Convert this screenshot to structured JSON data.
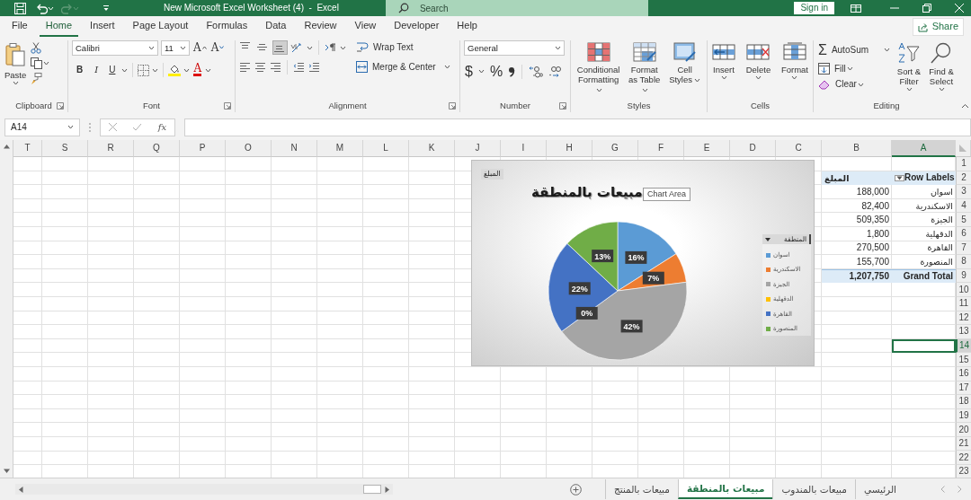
{
  "title_bar": {
    "title": "New Microsoft Excel Worksheet (4)  -  Excel",
    "redo_disabled": true,
    "search": {
      "placeholder": "Search"
    },
    "sign_in": "Sign in"
  },
  "menu": [
    {
      "label": "File",
      "selected": false
    },
    {
      "label": "Home",
      "selected": true
    },
    {
      "label": "Insert",
      "selected": false
    },
    {
      "label": "Page Layout",
      "selected": false
    },
    {
      "label": "Formulas",
      "selected": false
    },
    {
      "label": "Data",
      "selected": false
    },
    {
      "label": "Review",
      "selected": false
    },
    {
      "label": "View",
      "selected": false
    },
    {
      "label": "Developer",
      "selected": false
    },
    {
      "label": "Help",
      "selected": false
    }
  ],
  "share": "Share",
  "ribbon": {
    "clipboard": {
      "paste": "Paste",
      "label": "Clipboard"
    },
    "font": {
      "font_name": "Calibri",
      "font_size": "11",
      "grow": "A",
      "shrink": "A",
      "bold": "B",
      "italic": "I",
      "underline": "U",
      "font_color": "A",
      "label": "Font"
    },
    "alignment": {
      "vertical": [
        {
          "selected": false
        },
        {
          "selected": false
        },
        {
          "selected": true
        }
      ],
      "wrap_text": "Wrap Text",
      "merge": "Merge & Center",
      "label": "Alignment"
    },
    "number": {
      "format": "General",
      "currency": "$",
      "percent": "%",
      "label": "Number"
    },
    "styles": {
      "buttons": [
        {
          "label": "Conditional Formatting"
        },
        {
          "label": "Format as Table"
        },
        {
          "label": "Cell Styles"
        }
      ],
      "label": "Styles"
    },
    "cells": {
      "buttons": [
        {
          "label": "Insert"
        },
        {
          "label": "Delete"
        },
        {
          "label": "Format"
        }
      ],
      "label": "Cells"
    },
    "editing": {
      "autosum_sign": "Σ",
      "autosum": "AutoSum",
      "fill": "Fill",
      "clear": "Clear",
      "sort": "Sort & Filter",
      "find": "Find & Select",
      "label": "Editing"
    }
  },
  "formula_bar": {
    "name_box": "A14",
    "function_sign": "fx"
  },
  "sheet": {
    "columns": [
      {
        "label": "T",
        "selected": false
      },
      {
        "label": "S",
        "selected": false
      },
      {
        "label": "R",
        "selected": false
      },
      {
        "label": "Q",
        "selected": false
      },
      {
        "label": "P",
        "selected": false
      },
      {
        "label": "O",
        "selected": false
      },
      {
        "label": "N",
        "selected": false
      },
      {
        "label": "M",
        "selected": false
      },
      {
        "label": "L",
        "selected": false
      },
      {
        "label": "K",
        "selected": false
      },
      {
        "label": "J",
        "selected": false
      },
      {
        "label": "I",
        "selected": false
      },
      {
        "label": "H",
        "selected": false
      },
      {
        "label": "G",
        "selected": false
      },
      {
        "label": "F",
        "selected": false
      },
      {
        "label": "E",
        "selected": false
      },
      {
        "label": "D",
        "selected": false
      },
      {
        "label": "C",
        "selected": false
      },
      {
        "label": "B",
        "selected": false
      },
      {
        "label": "A",
        "selected": true
      }
    ],
    "rows": [
      {
        "label": "1",
        "selected": false
      },
      {
        "label": "2",
        "selected": false
      },
      {
        "label": "3",
        "selected": false
      },
      {
        "label": "4",
        "selected": false
      },
      {
        "label": "5",
        "selected": false
      },
      {
        "label": "6",
        "selected": false
      },
      {
        "label": "7",
        "selected": false
      },
      {
        "label": "8",
        "selected": false
      },
      {
        "label": "9",
        "selected": false
      },
      {
        "label": "10",
        "selected": false
      },
      {
        "label": "11",
        "selected": false
      },
      {
        "label": "12",
        "selected": false
      },
      {
        "label": "13",
        "selected": false
      },
      {
        "label": "14",
        "selected": true
      },
      {
        "label": "15",
        "selected": false
      },
      {
        "label": "16",
        "selected": false
      },
      {
        "label": "17",
        "selected": false
      },
      {
        "label": "18",
        "selected": false
      },
      {
        "label": "19",
        "selected": false
      },
      {
        "label": "20",
        "selected": false
      },
      {
        "label": "21",
        "selected": false
      },
      {
        "label": "22",
        "selected": false
      },
      {
        "label": "23",
        "selected": false
      }
    ],
    "pivot": {
      "header": {
        "label": "Row Labels",
        "value": "المبلغ"
      },
      "rows": [
        {
          "label": "اسوان",
          "value": "188,000"
        },
        {
          "label": "الاسكندرية",
          "value": "82,400"
        },
        {
          "label": "الجيزة",
          "value": "509,350"
        },
        {
          "label": "الدقهلية",
          "value": "1,800"
        },
        {
          "label": "القاهرة",
          "value": "270,500"
        },
        {
          "label": "المنصورة",
          "value": "155,700"
        }
      ],
      "total": {
        "label": "Grand Total",
        "value": "1,207,750"
      }
    }
  },
  "chart": {
    "title": "مبيعات بالمنطقة",
    "tooltip": "Chart Area",
    "legend": {
      "field": "المنطقة",
      "items": [
        {
          "color": "#5b9bd5"
        },
        {
          "color": "#ed7d31"
        },
        {
          "color": "#a5a5a5"
        },
        {
          "color": "#ffc000"
        },
        {
          "color": "#4472c4"
        },
        {
          "color": "#70ad47"
        }
      ]
    },
    "chart_data": {
      "type": "pie",
      "categories": [
        "اسوان",
        "الاسكندرية",
        "الجيزة",
        "الدقهلية",
        "القاهرة",
        "المنصورة"
      ],
      "series": [
        {
          "name": "المبلغ",
          "values": [
            16,
            7,
            42,
            0,
            22,
            13
          ]
        }
      ],
      "value_labels": [
        "16%",
        "7%",
        "42%",
        "0%",
        "22%",
        "13%"
      ]
    }
  },
  "sheet_tabs": [
    {
      "label": "الرئيسي",
      "selected": false
    },
    {
      "label": "مبيعات بالمندوب",
      "selected": false
    },
    {
      "label": "مبيعات بالمنطقة",
      "selected": true
    },
    {
      "label": "مبيعات بالمنتج",
      "selected": false
    }
  ]
}
